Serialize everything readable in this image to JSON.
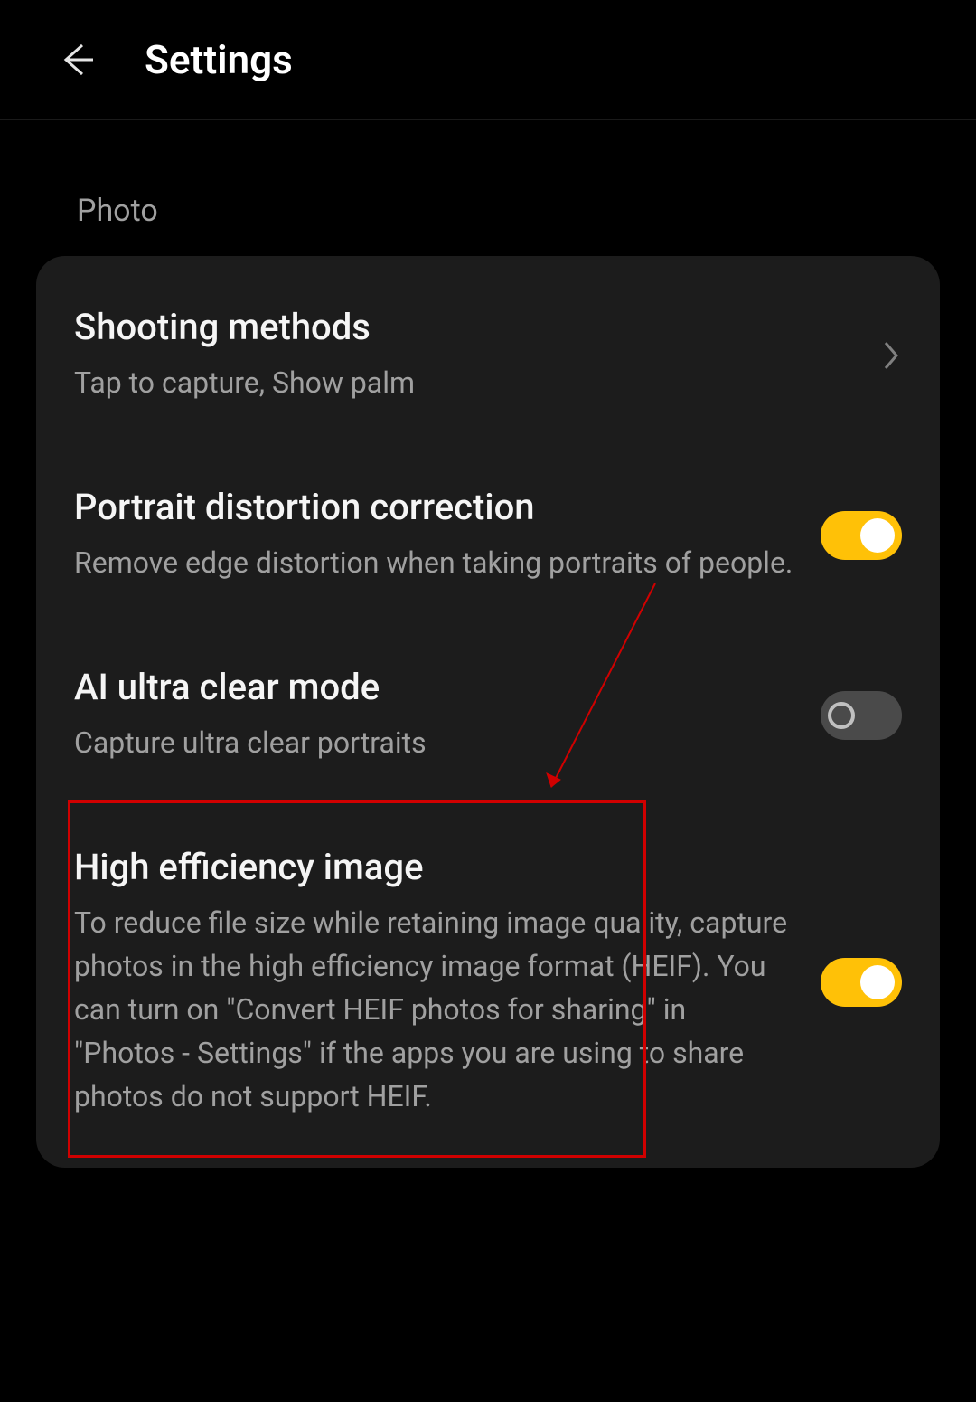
{
  "header": {
    "title": "Settings"
  },
  "section": {
    "label": "Photo"
  },
  "settings": {
    "shooting_methods": {
      "title": "Shooting methods",
      "description": "Tap to capture, Show palm"
    },
    "portrait_distortion": {
      "title": "Portrait distortion correction",
      "description": "Remove edge distortion when taking portraits of people.",
      "enabled": true
    },
    "ai_ultra_clear": {
      "title": "AI ultra clear mode",
      "description": "Capture ultra clear portraits",
      "enabled": false
    },
    "high_efficiency": {
      "title": "High efficiency image",
      "description": "To reduce file size while retaining image quality, capture photos in the high efficiency image format (HEIF). You can turn on \"Convert HEIF photos for sharing\" in \"Photos - Settings\" if the apps you are using to share photos do not support HEIF.",
      "enabled": true
    }
  }
}
